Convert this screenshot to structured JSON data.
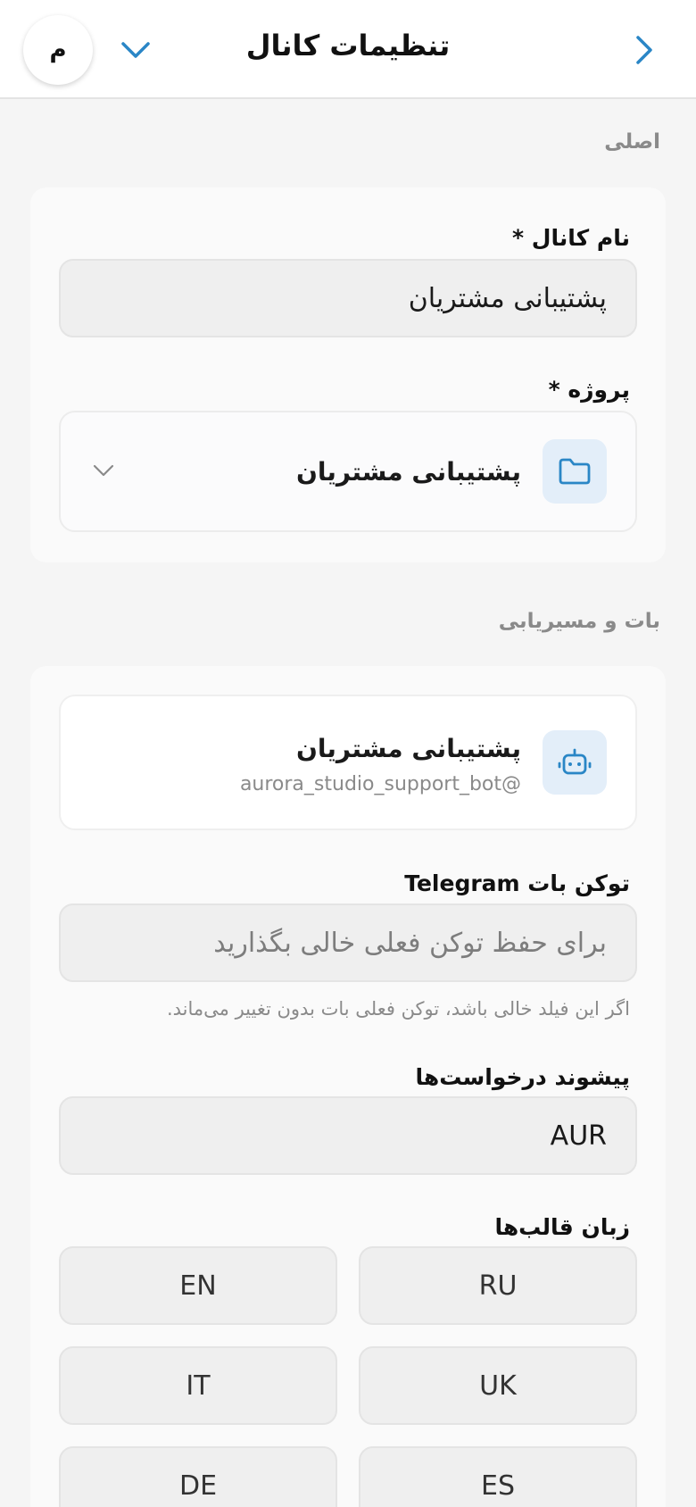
{
  "header": {
    "title": "تنظیمات کانال",
    "avatar_letter": "م",
    "back_icon": "chevron-right-icon",
    "menu_icon": "chevron-down-icon"
  },
  "section_main": {
    "title": "اصلی",
    "channel_name_label": "نام کانال *",
    "channel_name_value": "پشتیبانی مشتریان",
    "project_label": "پروژه *",
    "project_value": "پشتیبانی مشتریان",
    "project_icon": "folder-icon"
  },
  "section_bot": {
    "title": "بات و مسیریابی",
    "bot_name": "پشتیبانی مشتریان",
    "bot_handle": "@aurora_studio_support_bot",
    "bot_icon": "robot-icon",
    "token_label": "توکن بات Telegram",
    "token_placeholder": "برای حفظ توکن فعلی خالی بگذارید",
    "token_help": "اگر این فیلد خالی باشد، توکن فعلی بات بدون تغییر می‌ماند.",
    "prefix_label": "پیشوند درخواست‌ها",
    "prefix_value": "AUR",
    "templates_lang_label": "زبان قالب‌ها",
    "languages": [
      "RU",
      "EN",
      "UK",
      "IT",
      "ES",
      "DE"
    ]
  },
  "colors": {
    "accent": "#2a86c6",
    "background": "#f5f5f5"
  }
}
